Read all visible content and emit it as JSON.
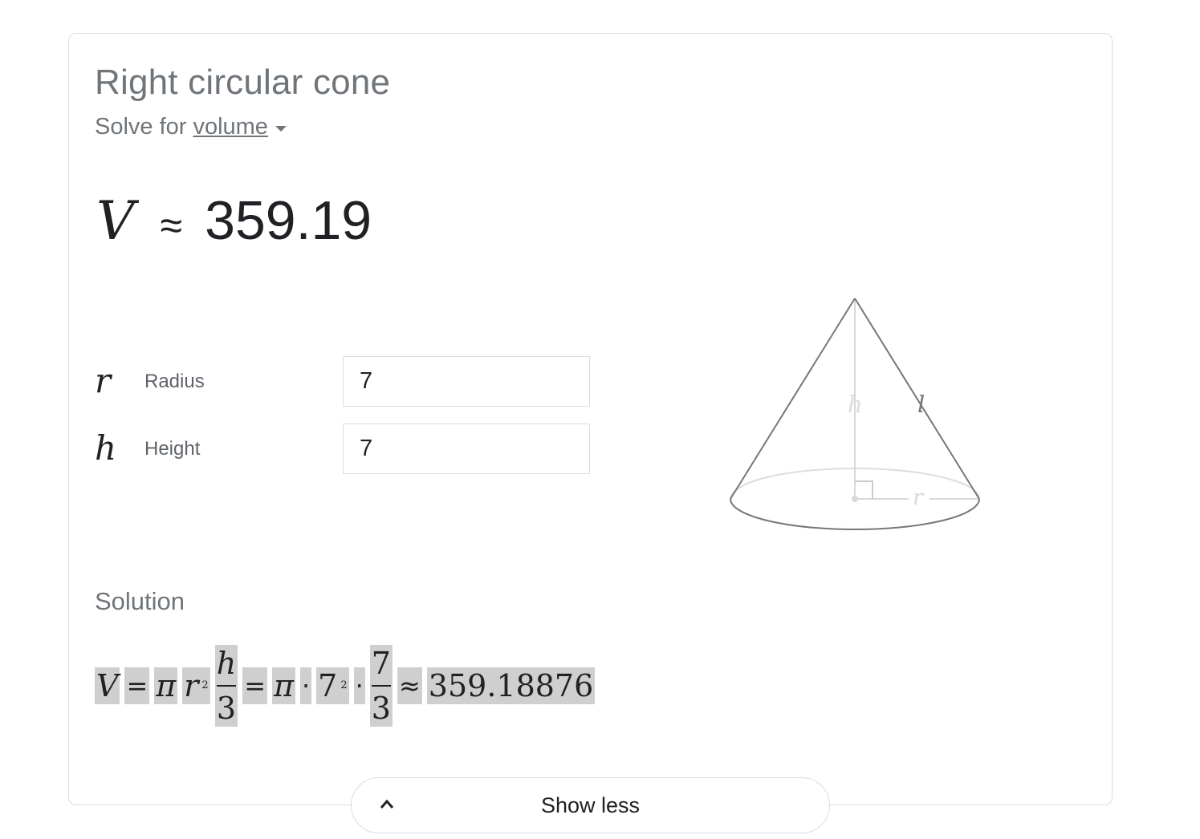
{
  "card": {
    "title": "Right circular cone",
    "solve_for_prefix": "Solve for",
    "solve_for_target": "volume"
  },
  "result": {
    "variable": "V",
    "approx_symbol": "≈",
    "value": "359.19"
  },
  "parameters": [
    {
      "symbol": "r",
      "label": "Radius",
      "value": "7"
    },
    {
      "symbol": "h",
      "label": "Height",
      "value": "7"
    }
  ],
  "diagram": {
    "height_label": "h",
    "slant_label": "l",
    "radius_label": "r"
  },
  "solution": {
    "heading": "Solution",
    "tokens": {
      "v": "V",
      "eq1": "=",
      "pi1": "π",
      "r": "r",
      "r_exp": "2",
      "frac1_num": "h",
      "frac1_den": "3",
      "eq2": "=",
      "pi2": "π",
      "dot1": "·",
      "seven": "7",
      "seven_exp": "2",
      "dot2": "·",
      "frac2_num": "7",
      "frac2_den": "3",
      "approx": "≈",
      "value": "359.18876"
    }
  },
  "footer": {
    "show_less_label": "Show less"
  },
  "colors": {
    "title_gray": "#70757a",
    "text_dark": "#202124",
    "border": "#dadce0",
    "highlight": "#cfcfcf"
  }
}
